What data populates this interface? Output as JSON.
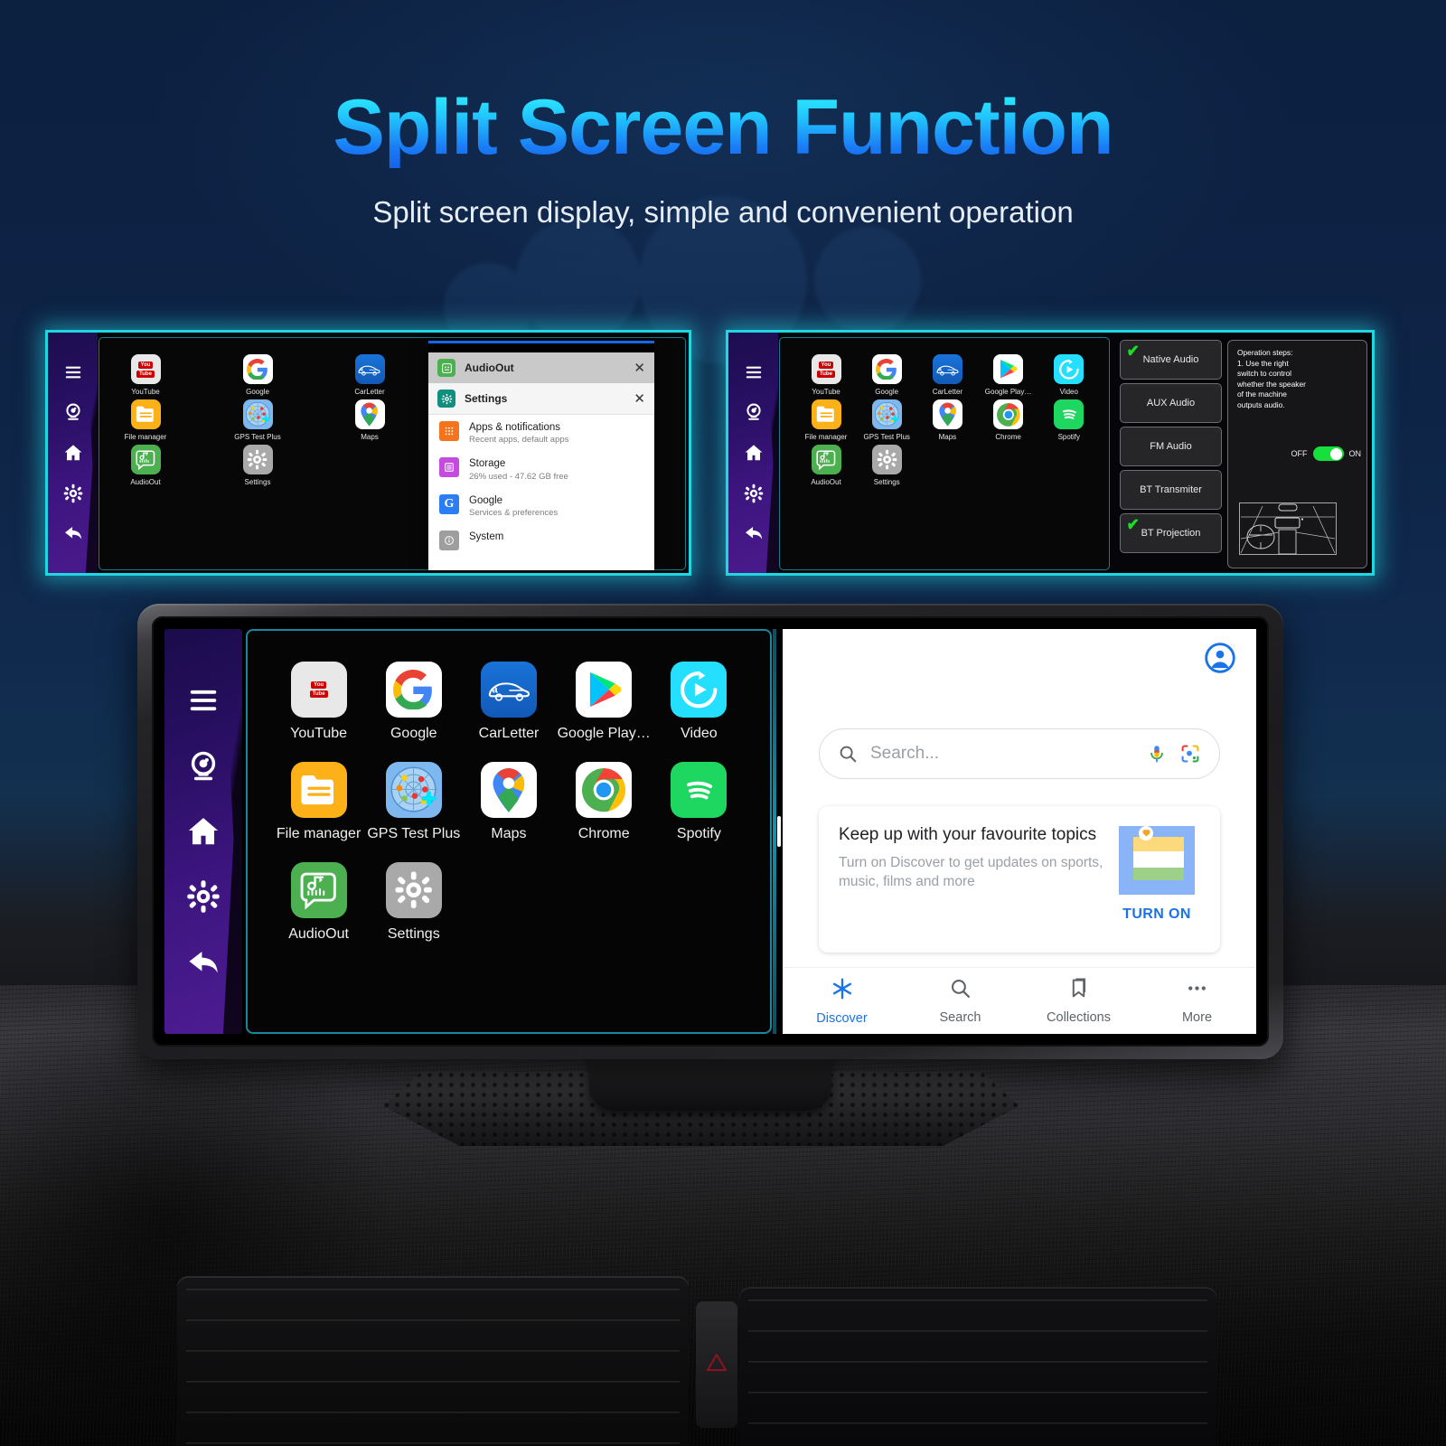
{
  "header": {
    "title": "Split Screen Function",
    "subtitle": "Split screen display, simple and convenient operation"
  },
  "colors": {
    "accent_cyan": "#21d6e0",
    "title_gradient_start": "#2ff6ff",
    "title_gradient_end": "#1565e8",
    "google_blue": "#1a73e8",
    "toggle_green": "#16e03b",
    "check_green": "#19e024"
  },
  "sidebar": {
    "items": [
      {
        "name": "menu-icon",
        "label": "Menu"
      },
      {
        "name": "camera-icon",
        "label": "Camera"
      },
      {
        "name": "home-icon",
        "label": "Home"
      },
      {
        "name": "settings-gear-icon",
        "label": "Settings"
      },
      {
        "name": "back-arrow-icon",
        "label": "Back"
      }
    ]
  },
  "apps": [
    {
      "label": "YouTube",
      "icon": "youtube-icon"
    },
    {
      "label": "Google",
      "icon": "google-icon"
    },
    {
      "label": "CarLetter",
      "icon": "carletter-icon"
    },
    {
      "label": "Google Play…",
      "icon": "google-play-icon"
    },
    {
      "label": "Video",
      "icon": "video-icon"
    },
    {
      "label": "File manager",
      "icon": "file-manager-icon"
    },
    {
      "label": "GPS Test Plus",
      "icon": "gps-test-plus-icon"
    },
    {
      "label": "Maps",
      "icon": "maps-icon"
    },
    {
      "label": "Chrome",
      "icon": "chrome-icon"
    },
    {
      "label": "Spotify",
      "icon": "spotify-icon"
    },
    {
      "label": "AudioOut",
      "icon": "audioout-icon"
    },
    {
      "label": "Settings",
      "icon": "settings-app-icon"
    }
  ],
  "settings_window": {
    "audioout_title": "AudioOut",
    "settings_title": "Settings",
    "close_label": "✕",
    "items": [
      {
        "title": "Apps & notifications",
        "subtitle": "Recent apps, default apps",
        "icon": "apps-grid-icon"
      },
      {
        "title": "Storage",
        "subtitle": "26% used - 47.62 GB free",
        "icon": "storage-icon"
      },
      {
        "title": "Google",
        "subtitle": "Services & preferences",
        "icon": "google-g-icon"
      },
      {
        "title": "System",
        "subtitle": "",
        "icon": "system-info-icon"
      }
    ]
  },
  "audio_options": {
    "items": [
      {
        "label": "Native Audio",
        "checked": true
      },
      {
        "label": "AUX Audio",
        "checked": false
      },
      {
        "label": "FM Audio",
        "checked": false
      },
      {
        "label": "BT Transmiter",
        "checked": false
      },
      {
        "label": "BT Projection",
        "checked": true
      }
    ],
    "operation_steps": "Operation steps:\n1. Use the right switch to control whether the speaker of the machine outputs audio.",
    "toggle_off_label": "OFF",
    "toggle_on_label": "ON",
    "toggle_state": "ON"
  },
  "google_panel": {
    "search_placeholder": "Search...",
    "card": {
      "title": "Keep up with your favourite topics",
      "subtitle": "Turn on Discover to get updates on sports, music, films and more",
      "action": "TURN ON"
    },
    "nav": [
      {
        "label": "Discover",
        "icon": "discover-asterisk-icon",
        "active": true
      },
      {
        "label": "Search",
        "icon": "search-icon",
        "active": false
      },
      {
        "label": "Collections",
        "icon": "collections-bookmark-icon",
        "active": false
      },
      {
        "label": "More",
        "icon": "more-dots-icon",
        "active": false
      }
    ]
  }
}
